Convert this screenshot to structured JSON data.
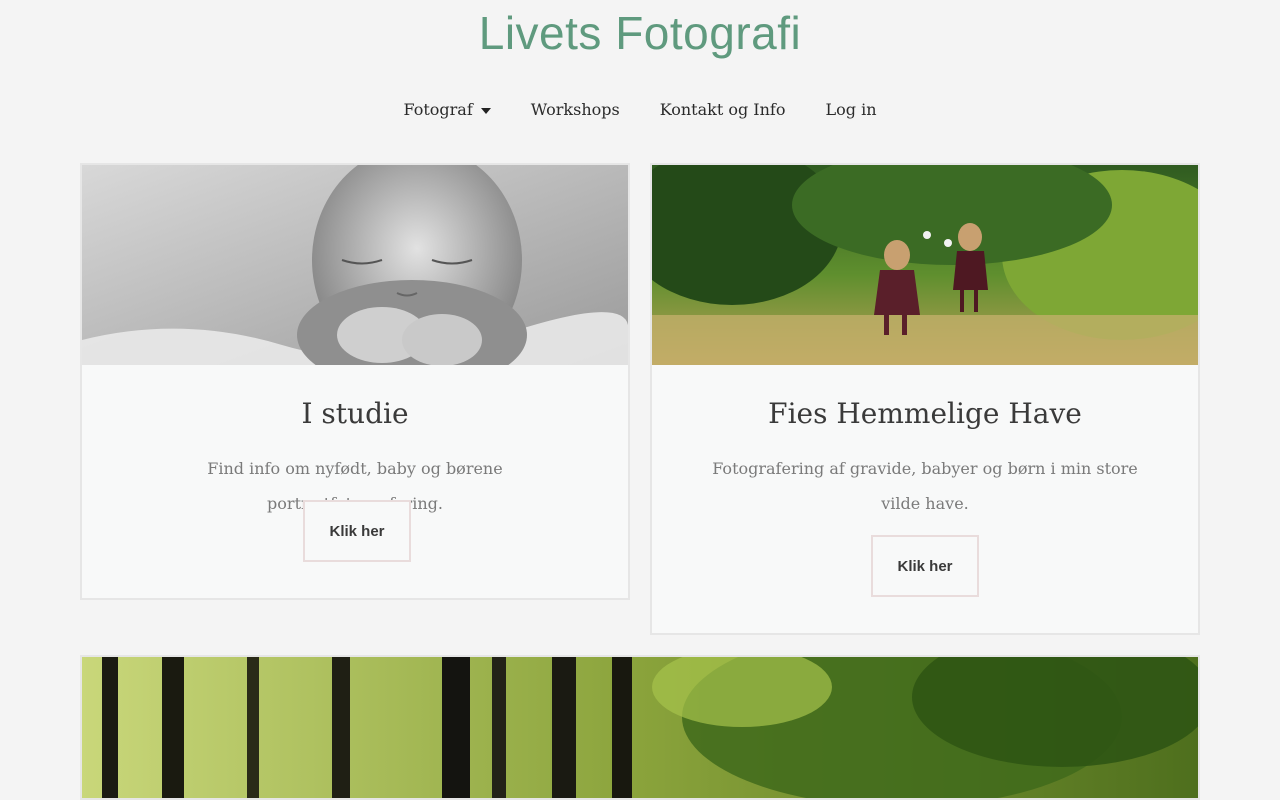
{
  "site": {
    "logo": "Livets Fotografi"
  },
  "nav": [
    {
      "label": "Fotograf",
      "has_dropdown": true
    },
    {
      "label": "Workshops"
    },
    {
      "label": "Kontakt og Info"
    },
    {
      "label": "Log in"
    }
  ],
  "cards": [
    {
      "title": "I studie",
      "description": "Find info om nyfødt, baby og børene portrætfotografering.",
      "button": "Klik her"
    },
    {
      "title": "Fies Hemmelige Have",
      "description": "Fotografering af gravide, babyer og børn i min store vilde have.",
      "button": "Klik her"
    }
  ],
  "colors": {
    "logo": "#5f9a7e",
    "background": "#f4f4f4",
    "card_bg": "#f8f9f9",
    "button_border": "#e9dcdc"
  }
}
